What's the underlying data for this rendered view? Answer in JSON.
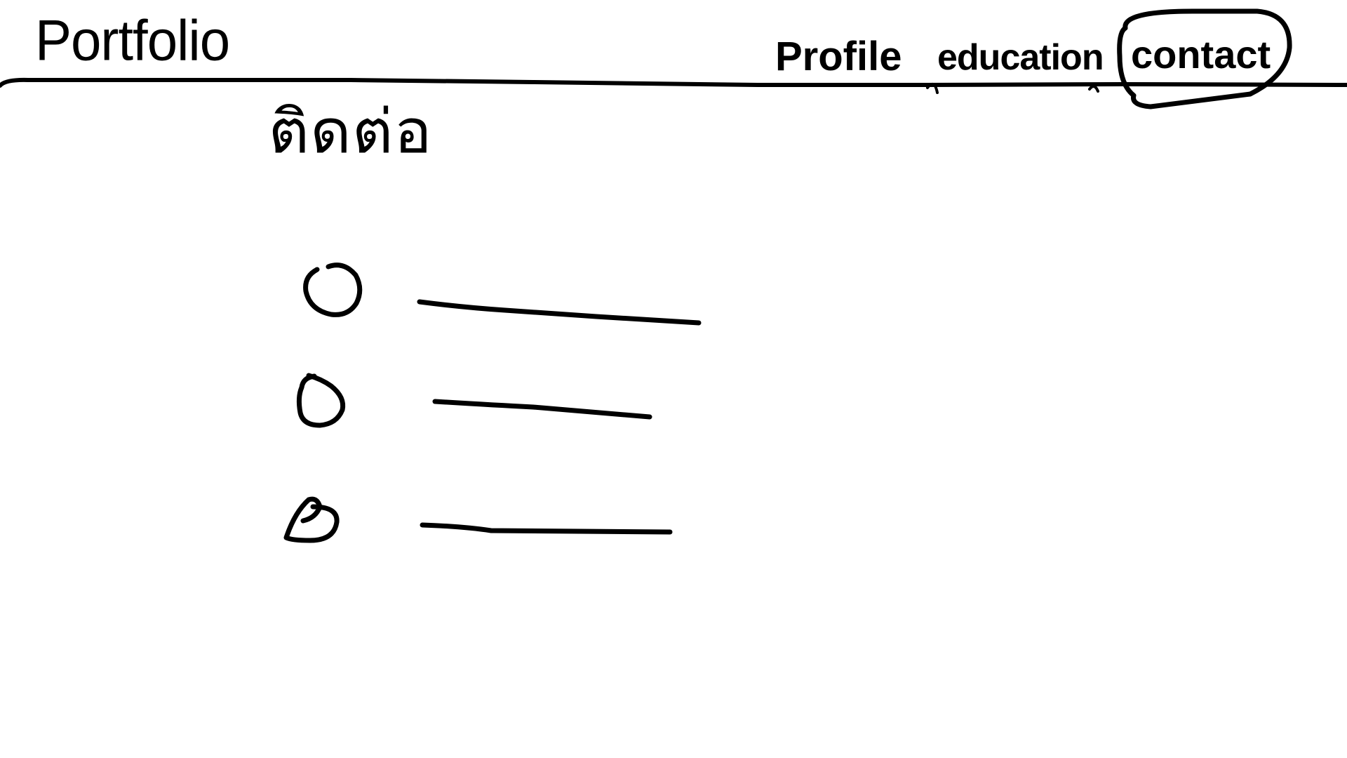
{
  "brand": {
    "title": "Portfolio"
  },
  "nav": {
    "items": [
      {
        "label": "Profile",
        "name": "profile"
      },
      {
        "label": "education",
        "name": "education"
      },
      {
        "label": "contact",
        "name": "contact",
        "selected": true
      }
    ]
  },
  "main": {
    "heading": "ติดต่อ",
    "contact_items": [
      {
        "icon": "circle-icon",
        "value": ""
      },
      {
        "icon": "circle-icon",
        "value": ""
      },
      {
        "icon": "circle-icon",
        "value": ""
      }
    ]
  },
  "colors": {
    "ink": "#000000",
    "background": "#ffffff"
  }
}
